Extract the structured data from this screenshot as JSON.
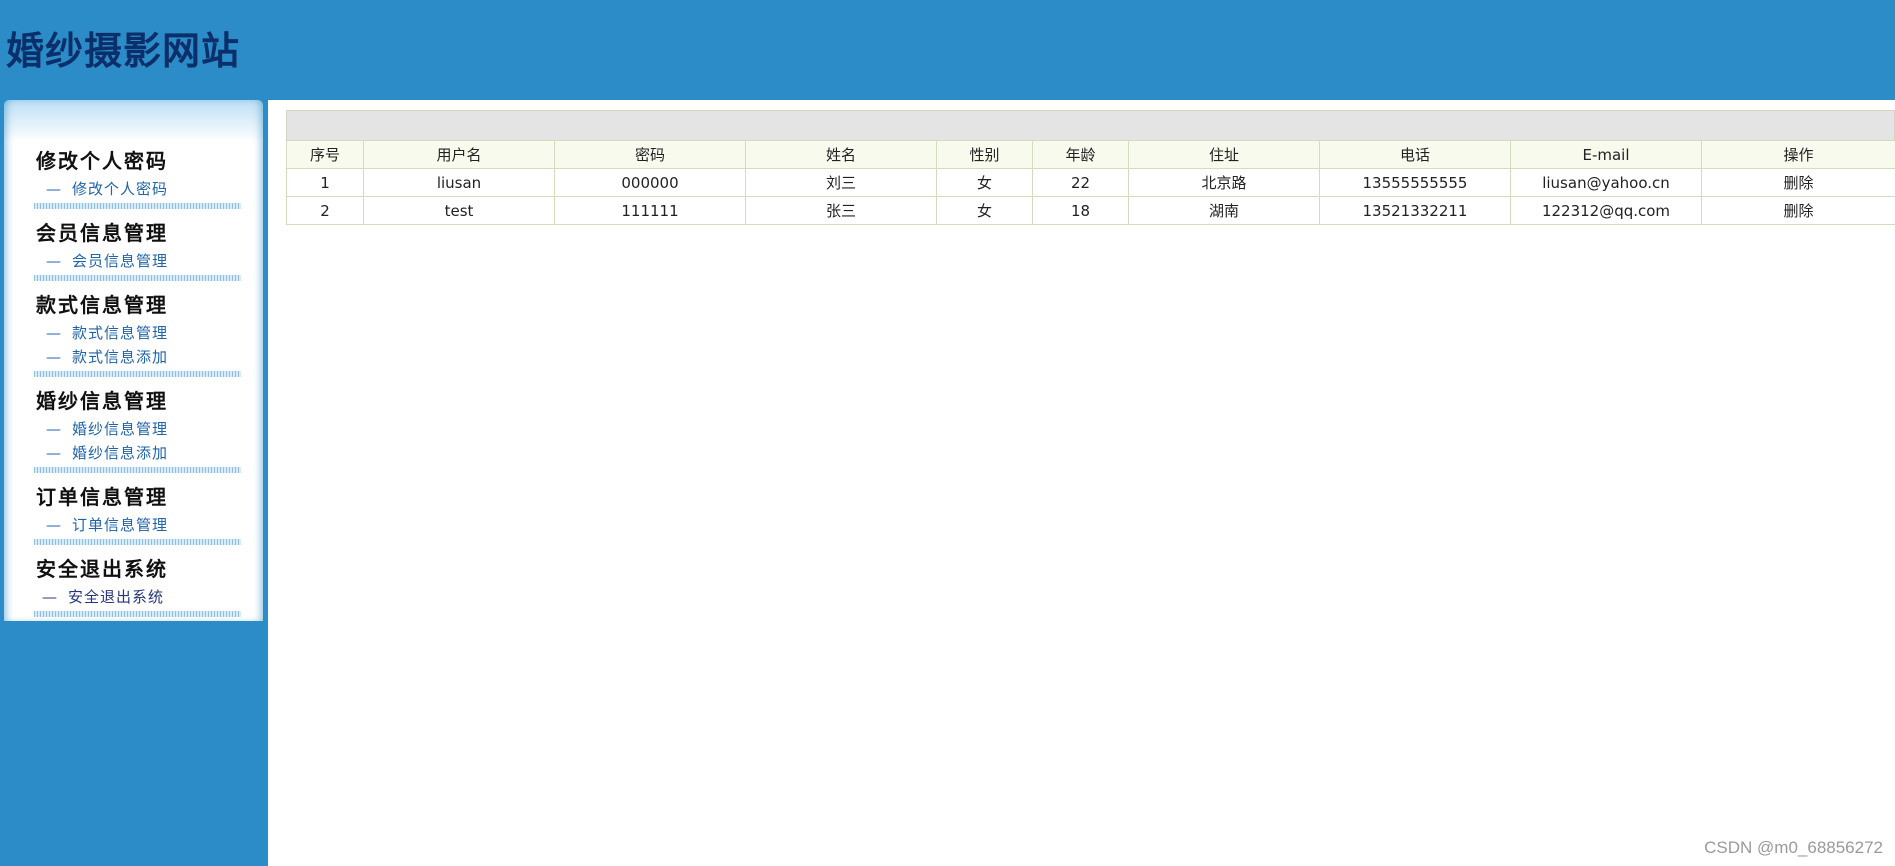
{
  "site": {
    "title": "婚纱摄影网站"
  },
  "sidebar": {
    "groups": [
      {
        "title": "修改个人密码",
        "items": [
          {
            "dash": "—",
            "label": "修改个人密码"
          }
        ]
      },
      {
        "title": "会员信息管理",
        "items": [
          {
            "dash": "—",
            "label": "会员信息管理"
          }
        ]
      },
      {
        "title": "款式信息管理",
        "items": [
          {
            "dash": "—",
            "label": "款式信息管理"
          },
          {
            "dash": "—",
            "label": "款式信息添加"
          }
        ]
      },
      {
        "title": "婚纱信息管理",
        "items": [
          {
            "dash": "—",
            "label": "婚纱信息管理"
          },
          {
            "dash": "—",
            "label": "婚纱信息添加"
          }
        ]
      },
      {
        "title": "订单信息管理",
        "items": [
          {
            "dash": "—",
            "label": "订单信息管理"
          }
        ]
      },
      {
        "title": "安全退出系统",
        "items": [
          {
            "dash": "—",
            "label": "安全退出系统"
          }
        ]
      }
    ]
  },
  "table": {
    "headers": [
      "序号",
      "用户名",
      "密码",
      "姓名",
      "性别",
      "年龄",
      "住址",
      "电话",
      "E-mail",
      "操作"
    ],
    "rows": [
      [
        "1",
        "liusan",
        "000000",
        "刘三",
        "女",
        "22",
        "北京路",
        "13555555555",
        "liusan@yahoo.cn",
        "删除"
      ],
      [
        "2",
        "test",
        "111111",
        "张三",
        "女",
        "18",
        "湖南",
        "13521332211",
        "122312@qq.com",
        "删除"
      ]
    ]
  },
  "watermark": "CSDN @m0_68856272",
  "colors": {
    "header_bg": "#2b8cc8",
    "title_text": "#0b2f6a",
    "link": "#1f63a8"
  }
}
